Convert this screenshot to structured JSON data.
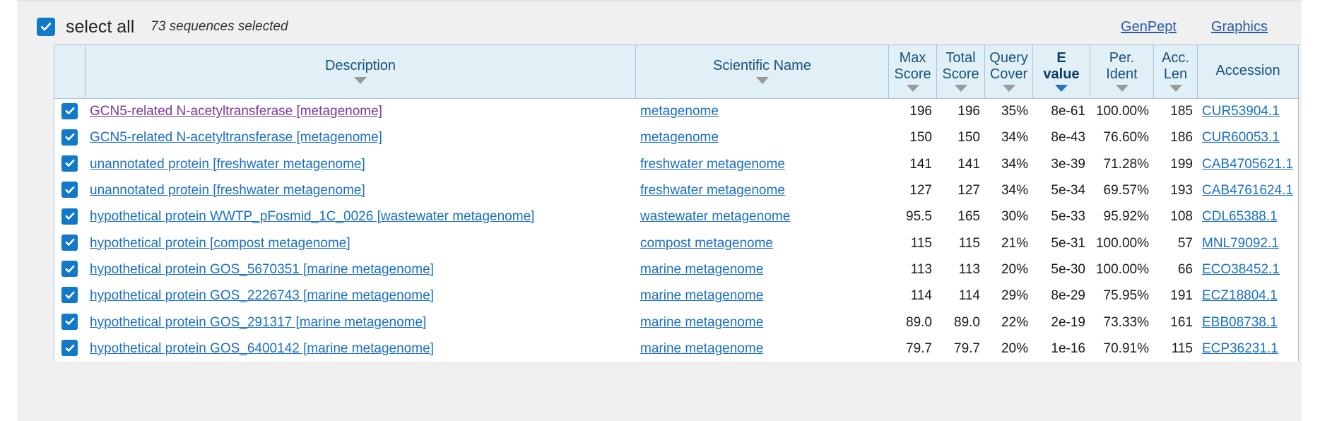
{
  "toolbar": {
    "select_all_label": "select all",
    "selected_count": "73 sequences selected",
    "genpept_label": "GenPept",
    "graphics_label": "Graphics"
  },
  "colors": {
    "accent": "#1278c8",
    "link": "#1a6fc4",
    "visited_link": "#7b3a96",
    "header_bg": "#e1f0f7",
    "header_text": "#18527e",
    "page_bg": "#f0f0f0",
    "active_sort": "#2a6fc9"
  },
  "table": {
    "columns": [
      {
        "key": "checkbox",
        "label": "",
        "sortable": false,
        "active": false
      },
      {
        "key": "description",
        "label": "Description",
        "sortable": true,
        "active": false
      },
      {
        "key": "scientific",
        "label": "Scientific Name",
        "sortable": true,
        "active": false
      },
      {
        "key": "max_score",
        "label": "Max Score",
        "sortable": true,
        "active": false
      },
      {
        "key": "total_score",
        "label": "Total Score",
        "sortable": true,
        "active": false
      },
      {
        "key": "query_cover",
        "label": "Query Cover",
        "sortable": true,
        "active": false
      },
      {
        "key": "e_value",
        "label": "E value",
        "sortable": true,
        "active": true
      },
      {
        "key": "per_ident",
        "label": "Per. Ident",
        "sortable": true,
        "active": false
      },
      {
        "key": "acc_len",
        "label": "Acc. Len",
        "sortable": true,
        "active": false
      },
      {
        "key": "accession",
        "label": "Accession",
        "sortable": false,
        "active": false
      }
    ],
    "header_lines": {
      "description": [
        "Description"
      ],
      "scientific": [
        "Scientific Name"
      ],
      "max_score": [
        "Max",
        "Score"
      ],
      "total_score": [
        "Total",
        "Score"
      ],
      "query_cover": [
        "Query",
        "Cover"
      ],
      "e_value": [
        "E",
        "value"
      ],
      "per_ident": [
        "Per.",
        "Ident"
      ],
      "acc_len": [
        "Acc.",
        "Len"
      ],
      "accession": [
        "Accession"
      ]
    },
    "rows": [
      {
        "checked": true,
        "description": "GCN5-related N-acetyltransferase [metagenome]",
        "description_visited": true,
        "scientific": "metagenome",
        "max_score": "196",
        "total_score": "196",
        "query_cover": "35%",
        "e_value": "8e-61",
        "per_ident": "100.00%",
        "acc_len": "185",
        "accession": "CUR53904.1"
      },
      {
        "checked": true,
        "description": "GCN5-related N-acetyltransferase [metagenome]",
        "description_visited": false,
        "scientific": "metagenome",
        "max_score": "150",
        "total_score": "150",
        "query_cover": "34%",
        "e_value": "8e-43",
        "per_ident": "76.60%",
        "acc_len": "186",
        "accession": "CUR60053.1"
      },
      {
        "checked": true,
        "description": "unannotated protein [freshwater metagenome]",
        "description_visited": false,
        "scientific": "freshwater metagenome",
        "max_score": "141",
        "total_score": "141",
        "query_cover": "34%",
        "e_value": "3e-39",
        "per_ident": "71.28%",
        "acc_len": "199",
        "accession": "CAB4705621.1"
      },
      {
        "checked": true,
        "description": "unannotated protein [freshwater metagenome]",
        "description_visited": false,
        "scientific": "freshwater metagenome",
        "max_score": "127",
        "total_score": "127",
        "query_cover": "34%",
        "e_value": "5e-34",
        "per_ident": "69.57%",
        "acc_len": "193",
        "accession": "CAB4761624.1"
      },
      {
        "checked": true,
        "description": "hypothetical protein WWTP_pFosmid_1C_0026 [wastewater metagenome]",
        "description_visited": false,
        "scientific": "wastewater metagenome",
        "max_score": "95.5",
        "total_score": "165",
        "query_cover": "30%",
        "e_value": "5e-33",
        "per_ident": "95.92%",
        "acc_len": "108",
        "accession": "CDL65388.1"
      },
      {
        "checked": true,
        "description": "hypothetical protein [compost metagenome]",
        "description_visited": false,
        "scientific": "compost metagenome",
        "max_score": "115",
        "total_score": "115",
        "query_cover": "21%",
        "e_value": "5e-31",
        "per_ident": "100.00%",
        "acc_len": "57",
        "accession": "MNL79092.1"
      },
      {
        "checked": true,
        "description": "hypothetical protein GOS_5670351 [marine metagenome]",
        "description_visited": false,
        "scientific": "marine metagenome",
        "max_score": "113",
        "total_score": "113",
        "query_cover": "20%",
        "e_value": "5e-30",
        "per_ident": "100.00%",
        "acc_len": "66",
        "accession": "ECO38452.1"
      },
      {
        "checked": true,
        "description": "hypothetical protein GOS_2226743 [marine metagenome]",
        "description_visited": false,
        "scientific": "marine metagenome",
        "max_score": "114",
        "total_score": "114",
        "query_cover": "29%",
        "e_value": "8e-29",
        "per_ident": "75.95%",
        "acc_len": "191",
        "accession": "ECZ18804.1"
      },
      {
        "checked": true,
        "description": "hypothetical protein GOS_291317 [marine metagenome]",
        "description_visited": false,
        "scientific": "marine metagenome",
        "max_score": "89.0",
        "total_score": "89.0",
        "query_cover": "22%",
        "e_value": "2e-19",
        "per_ident": "73.33%",
        "acc_len": "161",
        "accession": "EBB08738.1"
      },
      {
        "checked": true,
        "description": "hypothetical protein GOS_6400142 [marine metagenome]",
        "description_visited": false,
        "scientific": "marine metagenome",
        "max_score": "79.7",
        "total_score": "79.7",
        "query_cover": "20%",
        "e_value": "1e-16",
        "per_ident": "70.91%",
        "acc_len": "115",
        "accession": "ECP36231.1"
      }
    ]
  },
  "icons": {
    "checkmark": "check-icon",
    "sort_caret": "caret-down-icon"
  }
}
